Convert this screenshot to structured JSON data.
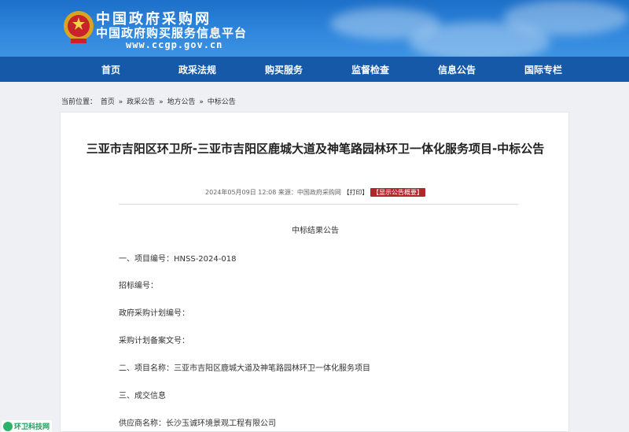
{
  "header": {
    "site_name": "中国政府采购网",
    "platform_name": "中国政府购买服务信息平台",
    "url": "www.ccgp.gov.cn"
  },
  "nav": {
    "items": [
      "首页",
      "政采法规",
      "购买服务",
      "监督检查",
      "信息公告",
      "国际专栏"
    ]
  },
  "breadcrumb": {
    "prefix": "当前位置：",
    "items": [
      "首页",
      "政采公告",
      "地方公告",
      "中标公告"
    ],
    "separator": "»"
  },
  "article": {
    "title": "三亚市吉阳区环卫所-三亚市吉阳区鹿城大道及神笔路园林环卫一体化服务项目-中标公告",
    "date": "2024年05月09日 12:08",
    "source": "来源：中国政府采购网",
    "print_label": "【打印】",
    "summary_label": "【显示公告概要】",
    "heading": "中标结果公告",
    "lines": [
      "一、项目编号：HNSS-2024-018",
      "招标编号：",
      "政府采购计划编号：",
      "采购计划备案文号：",
      "二、项目名称：三亚市吉阳区鹿城大道及神笔路园林环卫一体化服务项目",
      "三、成交信息",
      "供应商名称：长沙玉诚环境景观工程有限公司"
    ]
  },
  "watermark": {
    "text": "环卫科技网"
  },
  "colors": {
    "banner_blue": "#2f86dc",
    "nav_blue": "#1559a8",
    "summary_red": "#b3262c",
    "watermark_green": "#1aa35a"
  }
}
